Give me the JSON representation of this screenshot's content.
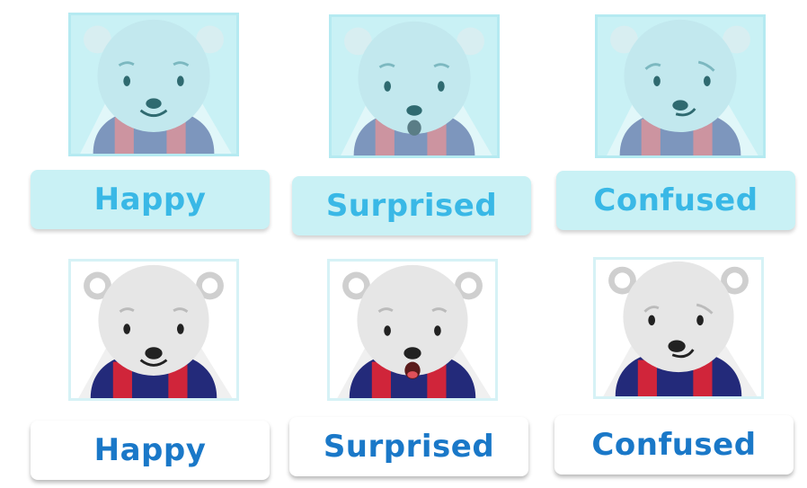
{
  "rows": [
    {
      "style": "tint",
      "cards": [
        {
          "label": "Happy",
          "expression": "happy"
        },
        {
          "label": "Surprised",
          "expression": "surprised"
        },
        {
          "label": "Confused",
          "expression": "confused"
        }
      ]
    },
    {
      "style": "plain",
      "cards": [
        {
          "label": "Happy",
          "expression": "happy"
        },
        {
          "label": "Surprised",
          "expression": "surprised"
        },
        {
          "label": "Confused",
          "expression": "confused"
        }
      ]
    }
  ],
  "colors": {
    "tint_bg": "#c9f1f5",
    "tint_text": "#39b8e6",
    "plain_text": "#1a78c8",
    "scarf_navy": "#232a7a",
    "scarf_red": "#d0253a",
    "bear_fur": "#e6e6e6"
  }
}
